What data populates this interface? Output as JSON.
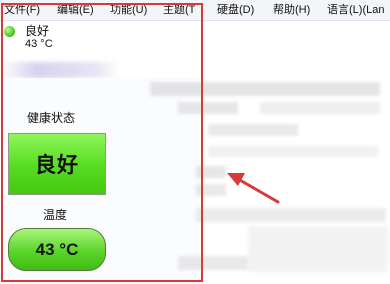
{
  "menu": {
    "items": [
      "文件(F)",
      "编辑(E)",
      "功能(U)",
      "主题(T",
      "硬盘(D)",
      "帮助(H)",
      "语言(L)(Lan"
    ]
  },
  "drive": {
    "status_text": "良好",
    "temperature_text": "43 °C"
  },
  "health": {
    "label": "健康状态",
    "value": "良好"
  },
  "temperature": {
    "label": "温度",
    "value": "43 °C"
  },
  "colors": {
    "good_green": "#57dc21",
    "annotation_red": "#d83a3a"
  }
}
